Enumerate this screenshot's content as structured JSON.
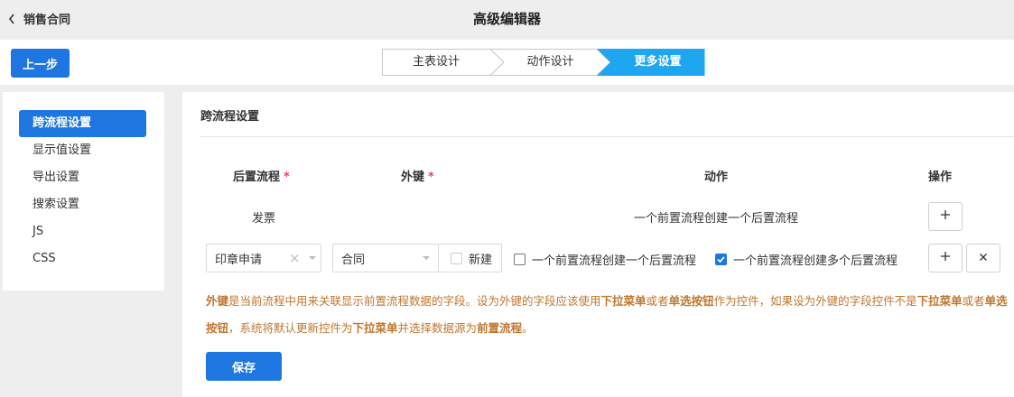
{
  "header": {
    "back_label": "销售合同",
    "title": "高级编辑器"
  },
  "stepbar": {
    "prev_label": "上一步",
    "steps": [
      {
        "label": "主表设计",
        "active": false
      },
      {
        "label": "动作设计",
        "active": false
      },
      {
        "label": "更多设置",
        "active": true
      }
    ]
  },
  "sidebar": {
    "items": [
      {
        "label": "跨流程设置",
        "active": true
      },
      {
        "label": "显示值设置",
        "active": false
      },
      {
        "label": "导出设置",
        "active": false
      },
      {
        "label": "搜索设置",
        "active": false
      },
      {
        "label": "JS",
        "active": false
      },
      {
        "label": "CSS",
        "active": false
      }
    ]
  },
  "main": {
    "section_title": "跨流程设置",
    "columns": {
      "downstream": "后置流程",
      "foreign_key": "外键",
      "action": "动作",
      "operation": "操作",
      "required_mark": "*"
    },
    "row1": {
      "downstream": "发票",
      "action": "一个前置流程创建一个后置流程"
    },
    "row2": {
      "downstream_value": "印章申请",
      "foreign_key_value": "合同",
      "new_label": "新建",
      "new_checked": false,
      "option_one_label": "一个前置流程创建一个后置流程",
      "option_one_checked": false,
      "option_many_label": "一个前置流程创建多个后置流程",
      "option_many_checked": true
    },
    "note_parts": [
      {
        "text": "外键",
        "bold": true
      },
      {
        "text": "是当前流程中用来关联显示前置流程数据的字段。设为外键的字段应该使用",
        "bold": false
      },
      {
        "text": "下拉菜单",
        "bold": true
      },
      {
        "text": "或者",
        "bold": false
      },
      {
        "text": "单选按钮",
        "bold": true
      },
      {
        "text": "作为控件，如果设为外键的字段控件不是",
        "bold": false
      },
      {
        "text": "下拉菜单",
        "bold": true
      },
      {
        "text": "或者",
        "bold": false
      },
      {
        "text": "单选按钮",
        "bold": true
      },
      {
        "text": "，系统将默认更新控件为",
        "bold": false
      },
      {
        "text": "下拉菜单",
        "bold": true
      },
      {
        "text": "并选择数据源为",
        "bold": false
      },
      {
        "text": "前置流程",
        "bold": true
      },
      {
        "text": "。",
        "bold": false
      }
    ],
    "save_label": "保存"
  },
  "colors": {
    "accent": "#1e76e0",
    "required": "#e8445a",
    "note": "#c0762e"
  },
  "icons": {
    "back": "chevron-left-icon",
    "add": "plus-icon",
    "remove": "close-icon",
    "dropdown": "caret-down-icon",
    "clear": "clear-x-icon",
    "check": "checkmark-icon"
  }
}
